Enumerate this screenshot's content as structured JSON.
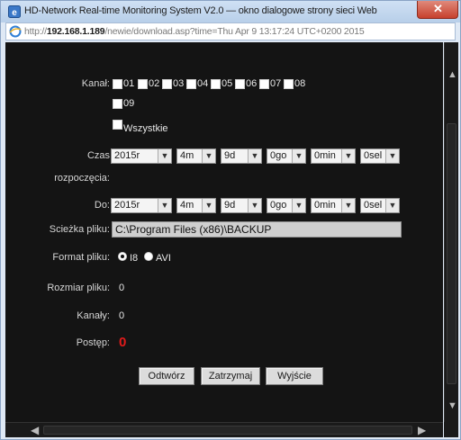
{
  "window": {
    "title": "HD-Network Real-time Monitoring System V2.0 — okno dialogowe strony sieci Web",
    "url_prefix": "http://",
    "url_host": "192.168.1.189",
    "url_path": "/newie/download.asp?time=Thu Apr 9 13:17:24 UTC+0200 2015"
  },
  "form": {
    "channel_label": "Kanał:",
    "channels": [
      "01",
      "02",
      "03",
      "04",
      "05",
      "06",
      "07",
      "08",
      "09"
    ],
    "all_label": "Wszystkie",
    "start_label_line1": "Czas",
    "start_label_line2": "rozpoczęcia:",
    "start": {
      "year": "2015r",
      "month": "4m",
      "day": "9d",
      "hour": "0go",
      "min": "0min",
      "sec": "0sel"
    },
    "end_label": "Do:",
    "end": {
      "year": "2015r",
      "month": "4m",
      "day": "9d",
      "hour": "0go",
      "min": "0min",
      "sec": "0sel"
    },
    "path_label": "Scieżka pliku:",
    "path_value": "C:\\Program Files (x86)\\BACKUP",
    "format_label": "Format pliku:",
    "format_options": [
      "I8",
      "AVI"
    ],
    "format_selected": "I8",
    "size_label": "Rozmiar pliku:",
    "size_value": "0",
    "channels_label": "Kanały:",
    "channels_value": "0",
    "progress_label": "Postęp:",
    "progress_value": "0"
  },
  "buttons": {
    "play": "Odtwórz",
    "stop": "Zatrzymaj",
    "exit": "Wyjście"
  },
  "colors": {
    "background": "#141414",
    "progress": "#e21b1b"
  }
}
